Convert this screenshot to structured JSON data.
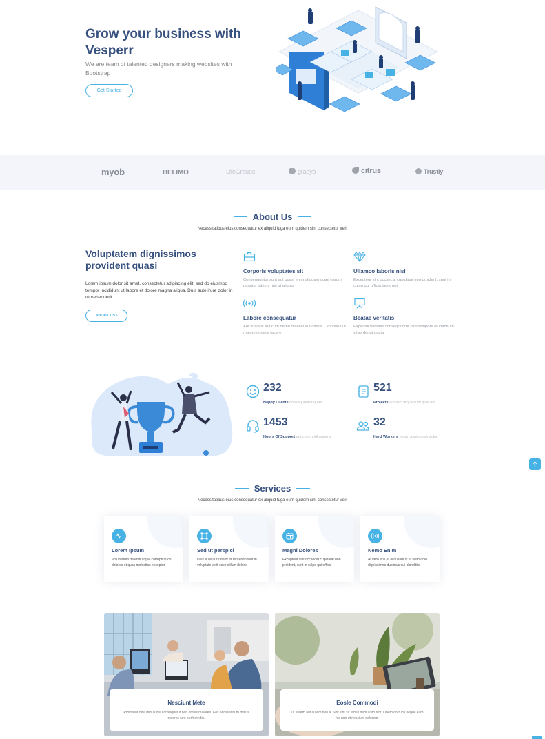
{
  "hero": {
    "title": "Grow your business with Vesperr",
    "subtitle": "We are team of talented designers making websites with Bootstrap",
    "cta_label": "Get Started"
  },
  "clients": [
    "myob",
    "BELIMO",
    "LifeGroups",
    "grabyo",
    "citrus",
    "Trustly"
  ],
  "about": {
    "section_title": "About Us",
    "section_subtitle": "Necessitatibus eius consequatur ex aliquid fuga eum quidem sint consectetur velit",
    "heading": "Voluptatem dignissimos provident quasi",
    "text": "Lorem ipsum dolor sit amet, consectetur adipiscing elit, sed do eiusmod tempor incididunt ut labore et dolore magna aliqua. Duis aute irure dolor in reprehenderit",
    "button_label": "ABOUT US",
    "features": [
      {
        "icon": "briefcase-icon",
        "title": "Corporis voluptates sit",
        "text": "Consequuntur sunt aut quasi enim aliquam quae harum pariatur laboris nisi ut aliquip"
      },
      {
        "icon": "gem-icon",
        "title": "Ullamco laboris nisi",
        "text": "Excepteur sint occaecat cupidatat non proident, sunt in culpa qui officia deserunt"
      },
      {
        "icon": "broadcast-icon",
        "title": "Labore consequatur",
        "text": "Aut suscipit aut cum nemo deleniti aut omnis. Doloribus ut maiores omnis facere"
      },
      {
        "icon": "easel-icon",
        "title": "Beatae veritatis",
        "text": "Expedita veritatis consequuntur nihil tempore laudantium vitae denat pacta"
      }
    ]
  },
  "counts": [
    {
      "icon": "smile-icon",
      "number": "232",
      "label_bold": "Happy Clients",
      "label_rest": "consequuntur quae"
    },
    {
      "icon": "journal-icon",
      "number": "521",
      "label_bold": "Projects",
      "label_rest": "adipisci atque cum quia aut"
    },
    {
      "icon": "headset-icon",
      "number": "1453",
      "label_bold": "Hours Of Support",
      "label_rest": "aut commodi quaerat"
    },
    {
      "icon": "people-icon",
      "number": "32",
      "label_bold": "Hard Workers",
      "label_rest": "rerum asperiores dolor"
    }
  ],
  "services": {
    "section_title": "Services",
    "section_subtitle": "Necessitatibus eius consequatur ex aliquid fuga eum quidem sint consectetur velit",
    "items": [
      {
        "icon": "activity-icon",
        "title": "Lorem Ipsum",
        "text": "Voluptatum deleniti atque corrupti quos dolores et quas molestias excepturi"
      },
      {
        "icon": "bounding-box-icon",
        "title": "Sed ut perspici",
        "text": "Duis aute irure dolor in reprehenderit in voluptate velit esse cillum dolore"
      },
      {
        "icon": "calendar-icon",
        "title": "Magni Dolores",
        "text": "Excepteur sint occaecat cupidatat non proident, sunt in culpa qui officia"
      },
      {
        "icon": "broadcast-icon",
        "title": "Nemo Enim",
        "text": "At vero eos et accusamus et iusto odio dignissimos ducimus qui blanditiis"
      }
    ]
  },
  "cards": [
    {
      "title": "Nesciunt Mete",
      "text": "Provident nihil minus qui consequatur non omnis maiores. Eos accusantium minus dolores iure perferendis."
    },
    {
      "title": "Eosle Commodi",
      "text": "Ut autem aut autem non a. Sint sint sit facilis nam iusto sint. Libero corrupti neque eum hic non ut nesciunt dolorem."
    }
  ],
  "colors": {
    "primary": "#37517e",
    "accent": "#47b2e4",
    "light_bg": "#f3f5fa"
  }
}
